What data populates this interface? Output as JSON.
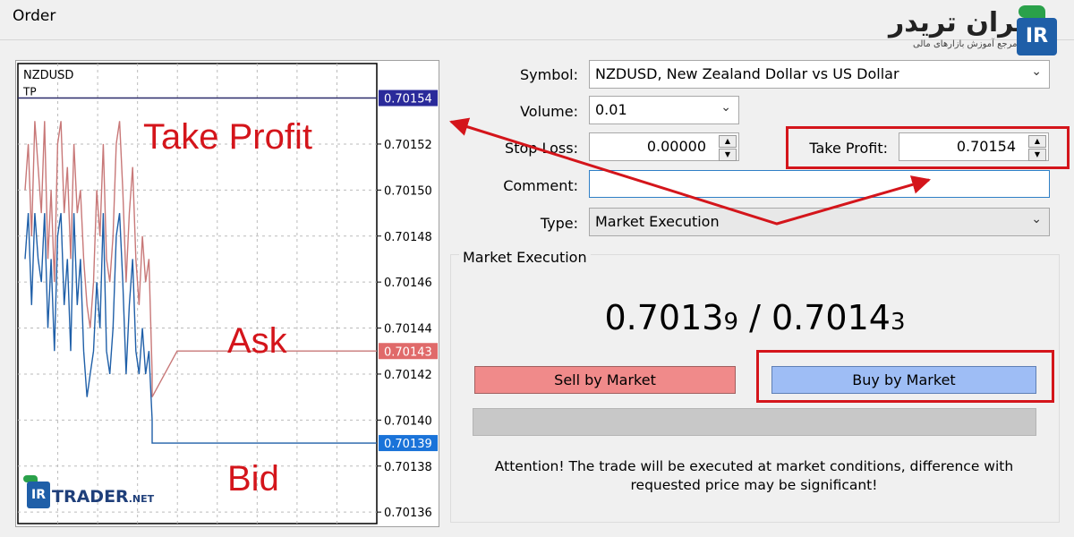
{
  "window": {
    "title": "Order"
  },
  "branding": {
    "logo_text_fa": "ایران تریدر",
    "logo_subtitle_fa": "مرجع آموزش بازارهای مالی",
    "badge": "IR",
    "watermark_badge": "IR",
    "watermark_text": "TRADER",
    "watermark_suffix": ".NET"
  },
  "chart": {
    "symbol": "NZDUSD",
    "tp_tag": "TP",
    "annotations": {
      "take_profit": "Take Profit",
      "ask": "Ask",
      "bid": "Bid"
    },
    "colors": {
      "ask": "#c87878",
      "bid": "#1f5fa8",
      "tp_line": "#2a2a6a",
      "annotation": "#d4151b",
      "ask_tag": "#e06a6a",
      "bid_tag": "#1a73d9",
      "tp_tag": "#2a2a9a"
    }
  },
  "chart_data": {
    "type": "line",
    "ylim": [
      0.701355,
      0.701555
    ],
    "y_ticks": [
      "0.70152",
      "0.70150",
      "0.70148",
      "0.70146",
      "0.70144",
      "0.70142",
      "0.70140",
      "0.70138",
      "0.70136"
    ],
    "y_tick_values": [
      0.70152,
      0.7015,
      0.70148,
      0.70146,
      0.70144,
      0.70142,
      0.7014,
      0.70138,
      0.70136
    ],
    "price_tags": [
      {
        "label": "0.70154",
        "value": 0.70154,
        "kind": "tp"
      },
      {
        "label": "0.70143",
        "value": 0.70143,
        "kind": "ask"
      },
      {
        "label": "0.70139",
        "value": 0.70139,
        "kind": "bid"
      }
    ],
    "series": [
      {
        "values": [
          0.7015,
          0.70152,
          0.70148,
          0.70153,
          0.70151,
          0.70149,
          0.70153,
          0.70147,
          0.7015,
          0.70146,
          0.70152,
          0.70153,
          0.70149,
          0.70151,
          0.70147,
          0.70152,
          0.70149,
          0.7015,
          0.70147,
          0.70145,
          0.70144,
          0.70146,
          0.7015,
          0.70148,
          0.70152,
          0.70147,
          0.70146,
          0.70148,
          0.70152,
          0.70153,
          0.7015,
          0.70146,
          0.70149,
          0.70151,
          0.70147,
          0.70145,
          0.70148,
          0.70146,
          0.70147,
          0.70142,
          0.70141,
          0.70143,
          0.70143,
          0.70143,
          0.70143,
          0.70143,
          0.70143,
          0.70143,
          0.70143,
          0.70143
        ]
      },
      {
        "values": [
          0.70147,
          0.70149,
          0.70145,
          0.70149,
          0.70147,
          0.70146,
          0.70149,
          0.70144,
          0.70147,
          0.70143,
          0.70148,
          0.70149,
          0.70145,
          0.70147,
          0.70143,
          0.70149,
          0.70145,
          0.70147,
          0.70143,
          0.70141,
          0.70142,
          0.70143,
          0.70146,
          0.70144,
          0.70149,
          0.70143,
          0.70142,
          0.70144,
          0.70148,
          0.70149,
          0.70146,
          0.70142,
          0.70145,
          0.70147,
          0.70143,
          0.70142,
          0.70144,
          0.70142,
          0.70143,
          0.7014,
          0.70139,
          0.70139,
          0.70139,
          0.70139,
          0.70139,
          0.70139,
          0.70139,
          0.70139,
          0.70139,
          0.70139
        ]
      }
    ]
  },
  "form": {
    "symbol_label": "Symbol:",
    "symbol_value": "NZDUSD, New Zealand Dollar vs US Dollar",
    "volume_label": "Volume:",
    "volume_value": "0.01",
    "stop_loss_label": "Stop Loss:",
    "stop_loss_value": "0.00000",
    "take_profit_label": "Take Profit:",
    "take_profit_value": "0.70154",
    "comment_label": "Comment:",
    "comment_value": "",
    "type_label": "Type:",
    "type_value": "Market Execution"
  },
  "execution": {
    "group_label": "Market Execution",
    "bid_main": "0.7013",
    "bid_small": "9",
    "separator": " / ",
    "ask_main": "0.7014",
    "ask_small": "3",
    "sell_label": "Sell by Market",
    "buy_label": "Buy by Market",
    "attention_line1": "Attention! The trade will be executed at market conditions, difference with",
    "attention_line2": "requested price may be significant!"
  }
}
